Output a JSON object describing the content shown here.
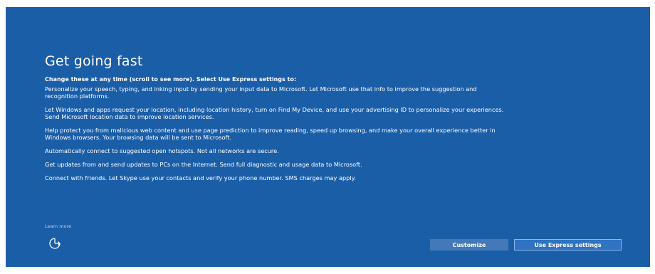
{
  "setup": {
    "title": "Get going fast",
    "subheading": "Change these at any time (scroll to see more). Select Use Express settings to:",
    "paragraphs": [
      "Personalize your speech, typing, and inking input by sending your input data to Microsoft. Let Microsoft use that info to improve the suggestion and recognition platforms.",
      "Let Windows and apps request your location, including location history, turn on Find My Device, and use your advertising ID to personalize your experiences. Send Microsoft location data to improve location services.",
      "Help protect you from malicious web content and use page prediction to improve reading, speed up browsing, and make your overall experience better in Windows browsers. Your browsing data will be sent to Microsoft.",
      "Automatically connect to suggested open hotspots. Not all networks are secure.",
      "Get updates from and send updates to PCs on the Internet. Send full diagnostic and usage data to Microsoft.",
      "Connect with friends. Let Skype use your contacts and verify your phone number. SMS charges may apply."
    ],
    "learn_more": "Learn more",
    "ease_of_access_icon": "ease-of-access-icon",
    "buttons": {
      "customize": "Customize",
      "express": "Use Express settings"
    }
  },
  "colors": {
    "background": "#1b5ea8",
    "button_customize": "#4379b7",
    "button_express": "#2f73c2"
  }
}
